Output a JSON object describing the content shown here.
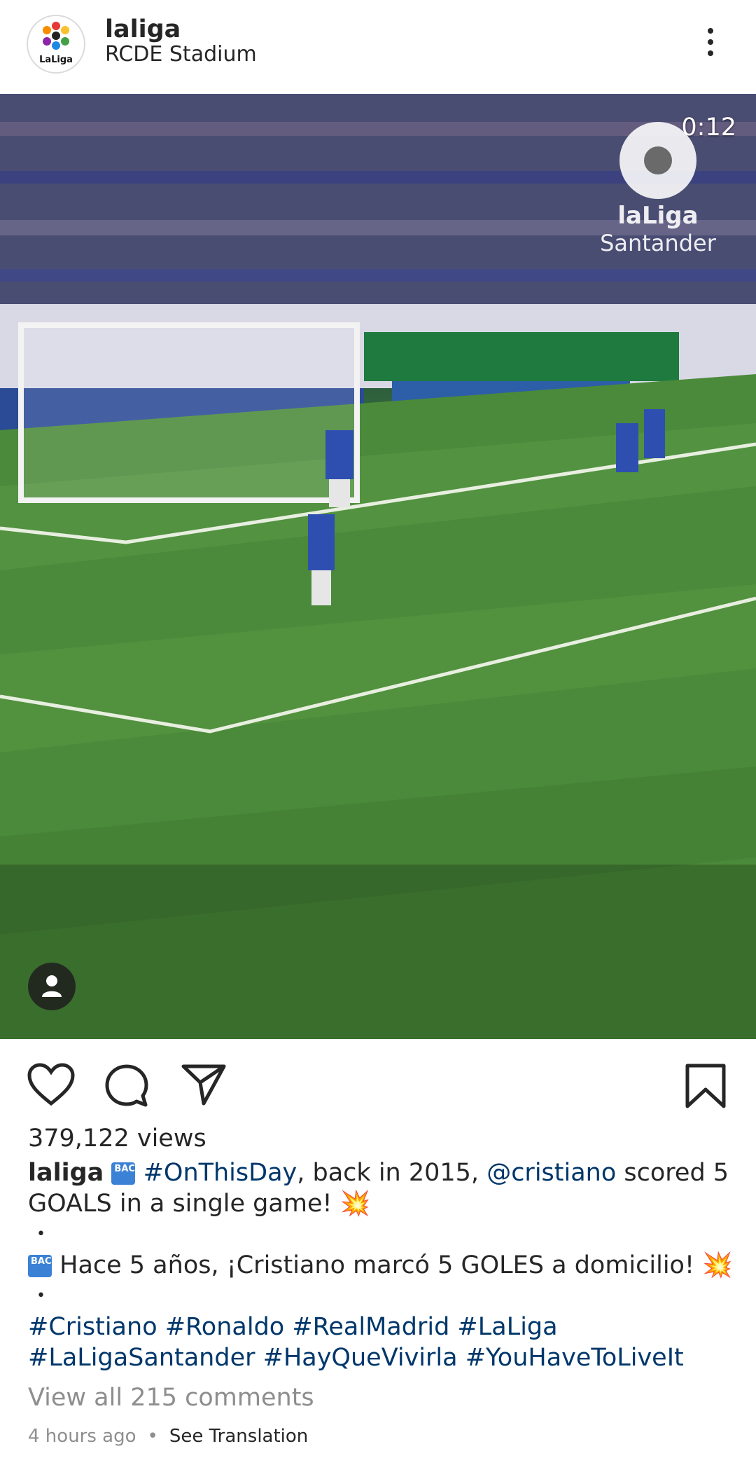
{
  "header": {
    "username": "laliga",
    "location": "RCDE Stadium",
    "avatar_logo_text": "LaLiga"
  },
  "video": {
    "timer": "0:12",
    "watermark_line1": "laLiga",
    "watermark_line2": "Santander"
  },
  "post": {
    "views": "379,122 views",
    "caption_user": "laliga",
    "back_emoji": "BACK",
    "hashtag_onthisday": "#OnThisDay",
    "caption_text1": ", back in 2015, ",
    "mention": "@cristiano",
    "caption_text2": " scored 5 GOALS in a single game! ",
    "boom_emoji": "💥",
    "dot": "•",
    "spanish_text": " Hace 5 años, ¡Cristiano marcó 5 GOLES a domicilio! ",
    "hashtags_line1": "#Cristiano #Ronaldo #RealMadrid #LaLiga",
    "hashtags_line2": "#LaLigaSantander #HayQueVivirla #YouHaveToLiveIt",
    "view_comments": "View all 215 comments",
    "time_ago": "4 hours ago",
    "separator": "•",
    "see_translation": "See Translation"
  },
  "icons": [
    "heart-icon",
    "comment-icon",
    "share-icon",
    "bookmark-icon",
    "more-icon",
    "user-tag-icon"
  ]
}
